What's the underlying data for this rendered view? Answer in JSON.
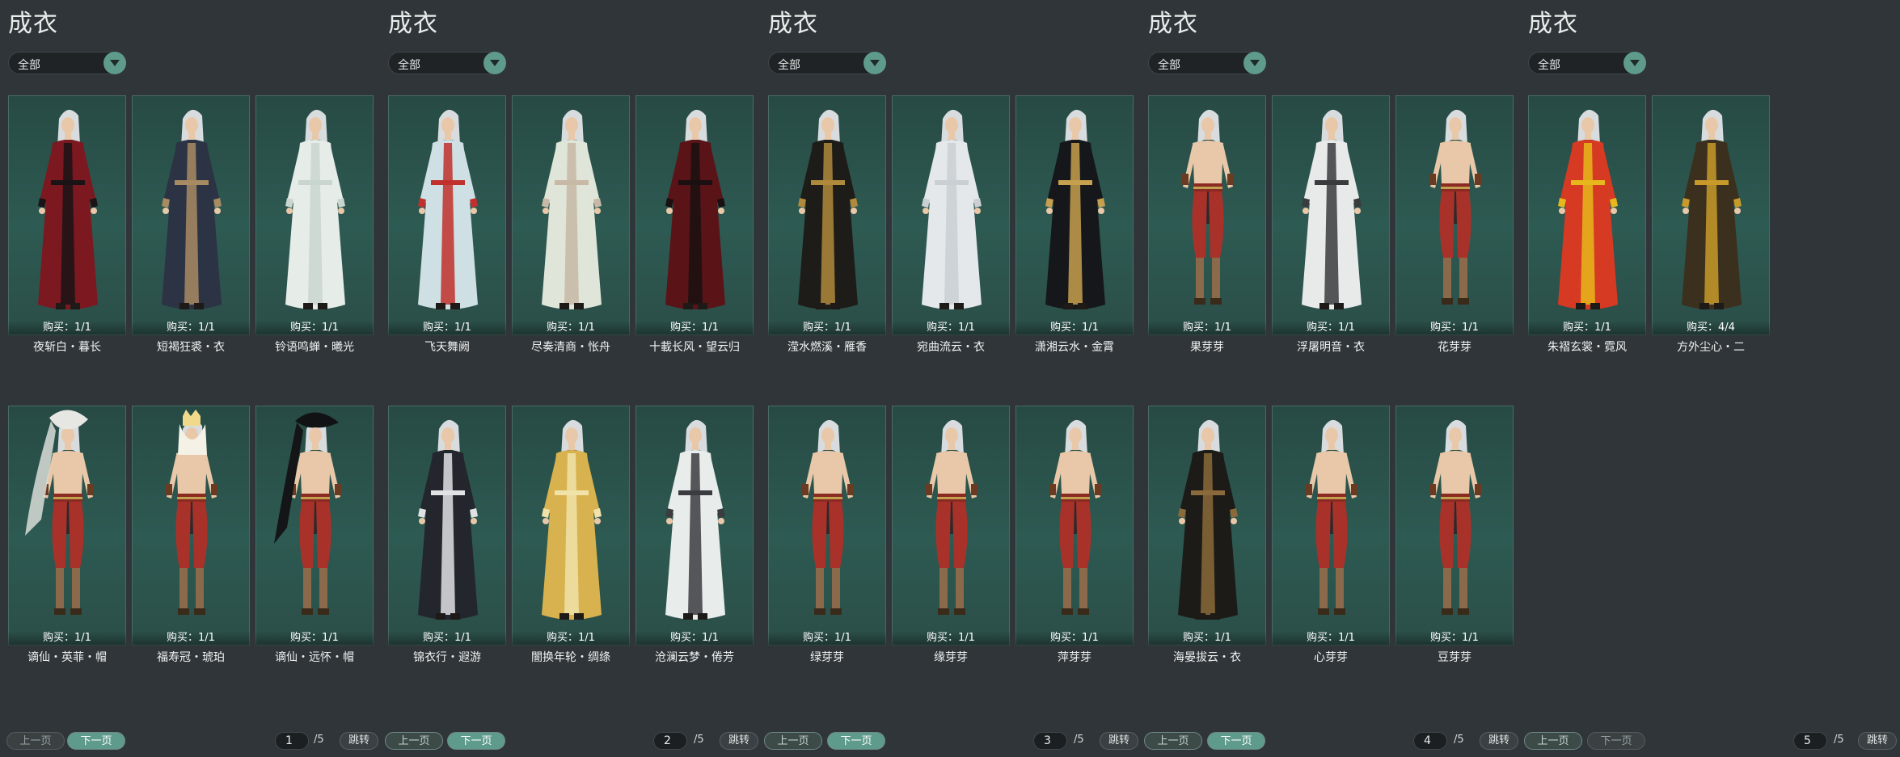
{
  "panels": [
    {
      "title": "成衣",
      "filter": "全部",
      "items": [
        {
          "name": "夜斩白・暮长",
          "qty": "购买：1/1",
          "robe": "#7b1820",
          "accent": "#1a1416",
          "style": "robe"
        },
        {
          "name": "短褐狂裘・衣",
          "qty": "购买：1/1",
          "robe": "#2b3345",
          "accent": "#a88b63",
          "style": "robe"
        },
        {
          "name": "铃语鸣蝉・曦光",
          "qty": "购买：1/1",
          "robe": "#e6ece8",
          "accent": "#c9d6d0",
          "style": "robe"
        },
        {
          "name": "谪仙・英菲・帽",
          "qty": "购买：1/1",
          "robe": "#a8322a",
          "accent": "#2a2a2a",
          "style": "bare",
          "hat": "veil-white"
        },
        {
          "name": "福寿冠・琥珀",
          "qty": "购买：1/1",
          "robe": "#a8322a",
          "accent": "#2a2a2a",
          "style": "bare",
          "hat": "crown"
        },
        {
          "name": "谪仙・远怀・帽",
          "qty": "购买：1/1",
          "robe": "#a8322a",
          "accent": "#2a2a2a",
          "style": "bare",
          "hat": "veil-black"
        }
      ],
      "pager": {
        "prev": "上一页",
        "next": "下一页",
        "page": "1",
        "total": "/5",
        "jump": "跳转",
        "prev_disabled": true
      }
    },
    {
      "title": "成衣",
      "filter": "全部",
      "items": [
        {
          "name": "飞天舞阙",
          "qty": "购买：1/1",
          "robe": "#cfe0e4",
          "accent": "#c0302c",
          "style": "robe"
        },
        {
          "name": "尽奏清商・怅舟",
          "qty": "购买：1/1",
          "robe": "#dfe5d8",
          "accent": "#c7b9a5",
          "style": "robe"
        },
        {
          "name": "十載长风・望云归",
          "qty": "购买：1/1",
          "robe": "#5a1418",
          "accent": "#1a1012",
          "style": "robe"
        },
        {
          "name": "锦衣行・遐游",
          "qty": "购买：1/1",
          "robe": "#23262c",
          "accent": "#e0e2e4",
          "style": "robe"
        },
        {
          "name": "闇换年轮・绸绦",
          "qty": "购买：1/1",
          "robe": "#d8b24e",
          "accent": "#f0e2a8",
          "style": "robe"
        },
        {
          "name": "沧澜云梦・倦芳",
          "qty": "购买：1/1",
          "robe": "#e8ecea",
          "accent": "#3a3c40",
          "style": "robe"
        }
      ],
      "pager": {
        "prev": "上一页",
        "next": "下一页",
        "page": "2",
        "total": "/5",
        "jump": "跳转",
        "prev_disabled": false
      }
    },
    {
      "title": "成衣",
      "filter": "全部",
      "items": [
        {
          "name": "滢水燃溪・雁香",
          "qty": "购买：1/1",
          "robe": "#1e1c18",
          "accent": "#b08a3c",
          "style": "robe"
        },
        {
          "name": "宛曲流云・衣",
          "qty": "购买：1/1",
          "robe": "#e4e8ea",
          "accent": "#c9cfd2",
          "style": "robe"
        },
        {
          "name": "潇湘云水・金霄",
          "qty": "购买：1/1",
          "robe": "#16171a",
          "accent": "#c6a04e",
          "style": "robe"
        },
        {
          "name": "绿芽芽",
          "qty": "购买：1/1",
          "robe": "#a8322a",
          "accent": "#2a2a2a",
          "style": "bare"
        },
        {
          "name": "缘芽芽",
          "qty": "购买：1/1",
          "robe": "#a8322a",
          "accent": "#2a2a2a",
          "style": "bare"
        },
        {
          "name": "萍芽芽",
          "qty": "购买：1/1",
          "robe": "#a8322a",
          "accent": "#2a2a2a",
          "style": "bare"
        }
      ],
      "pager": {
        "prev": "上一页",
        "next": "下一页",
        "page": "3",
        "total": "/5",
        "jump": "跳转",
        "prev_disabled": false
      }
    },
    {
      "title": "成衣",
      "filter": "全部",
      "items": [
        {
          "name": "果芽芽",
          "qty": "购买：1/1",
          "robe": "#a8322a",
          "accent": "#2a2a2a",
          "style": "bare"
        },
        {
          "name": "浮屠明音・衣",
          "qty": "购买：1/1",
          "robe": "#e8eaea",
          "accent": "#3a3b3d",
          "style": "robe"
        },
        {
          "name": "花芽芽",
          "qty": "购买：1/1",
          "robe": "#a8322a",
          "accent": "#2a2a2a",
          "style": "bare"
        },
        {
          "name": "海晏拔云・衣",
          "qty": "购买：1/1",
          "robe": "#1c1b18",
          "accent": "#8a6a3a",
          "style": "robe"
        },
        {
          "name": "心芽芽",
          "qty": "购买：1/1",
          "robe": "#a8322a",
          "accent": "#2a2a2a",
          "style": "bare"
        },
        {
          "name": "豆芽芽",
          "qty": "购买：1/1",
          "robe": "#a8322a",
          "accent": "#2a2a2a",
          "style": "bare"
        }
      ],
      "pager": {
        "prev": "上一页",
        "next": "下一页",
        "page": "4",
        "total": "/5",
        "jump": "跳转",
        "prev_disabled": false
      }
    },
    {
      "title": "成衣",
      "filter": "全部",
      "items": [
        {
          "name": "朱褶玄裳・霓风",
          "qty": "购买：1/1",
          "robe": "#d63a22",
          "accent": "#e6b81c",
          "style": "robe"
        },
        {
          "name": "方外尘心・二",
          "qty": "购买：4/4",
          "robe": "#3b2f1e",
          "accent": "#c89a2a",
          "style": "robe"
        }
      ],
      "pager": {
        "prev": "上一页",
        "next": "下一页",
        "page": "5",
        "total": "/5",
        "jump": "跳转",
        "prev_disabled": false,
        "next_disabled": true
      }
    }
  ]
}
